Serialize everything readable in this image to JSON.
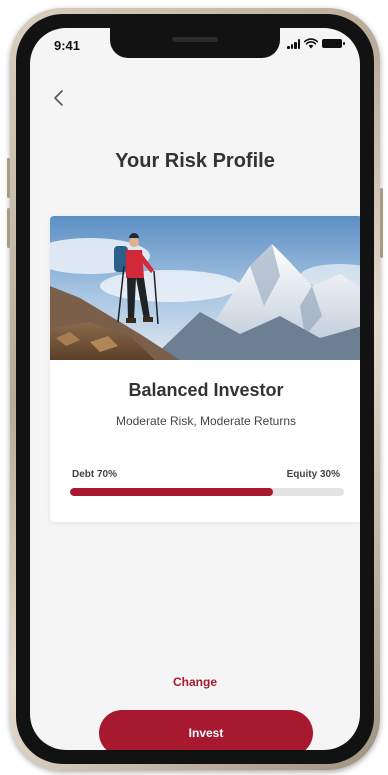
{
  "status_bar": {
    "time": "9:41",
    "icons": [
      "signal-icon",
      "wifi-icon",
      "battery-icon"
    ]
  },
  "navigation": {
    "back_icon": "chevron-left-icon"
  },
  "header": {
    "title": "Your Risk Profile"
  },
  "profile": {
    "hero_image": "mountain-hiker-image",
    "name": "Balanced Investor",
    "description": "Moderate Risk, Moderate Returns",
    "allocation": {
      "debt_label": "Debt 70%",
      "equity_label": "Equity 30%",
      "debt_percent": 74
    }
  },
  "actions": {
    "change_label": "Change",
    "invest_label": "Invest"
  },
  "colors": {
    "accent": "#a6192e",
    "track": "#e3e3e3",
    "background": "#f5f5f6",
    "title_text": "#333333"
  }
}
